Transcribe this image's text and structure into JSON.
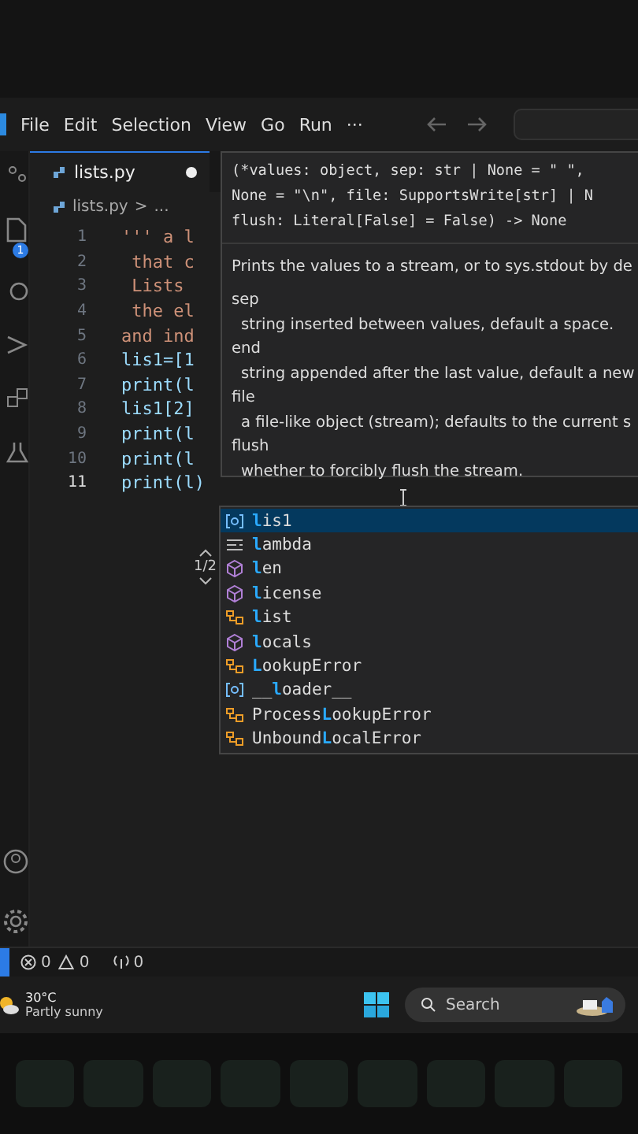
{
  "menu": [
    "File",
    "Edit",
    "Selection",
    "View",
    "Go",
    "Run",
    "···"
  ],
  "activity_badge": "1",
  "tab": {
    "label": "lists.py",
    "modified": true,
    "selected": true
  },
  "breadcrumb": [
    "lists.py",
    "..."
  ],
  "breadcrumb_separator": ">",
  "code_lines": [
    {
      "number": "1",
      "text": "''' a l",
      "kind": "string",
      "current": false
    },
    {
      "number": "2",
      "text": " that c",
      "kind": "string",
      "current": false
    },
    {
      "number": "3",
      "text": " Lists",
      "kind": "string",
      "current": false
    },
    {
      "number": "4",
      "text": " the el",
      "kind": "string",
      "current": false
    },
    {
      "number": "5",
      "text": "and ind",
      "kind": "string",
      "current": false
    },
    {
      "number": "6",
      "text": "lis1=[1",
      "kind": "code",
      "current": false
    },
    {
      "number": "7",
      "text": "print(l",
      "kind": "code",
      "current": false
    },
    {
      "number": "8",
      "text": "lis1[2]",
      "kind": "code",
      "current": false
    },
    {
      "number": "9",
      "text": "print(l",
      "kind": "code",
      "current": false
    },
    {
      "number": "10",
      "text": "print(l",
      "kind": "code",
      "current": false
    },
    {
      "number": "11",
      "text": "print(l)",
      "kind": "code",
      "current": true
    }
  ],
  "hover": {
    "overload": "1/2",
    "signature": [
      "(*values: object, sep: str | None = \" \",",
      "None = \"\\n\", file: SupportsWrite[str] | N",
      "flush: Literal[False] = False) -> None"
    ],
    "summary": "Prints the values to a stream, or to sys.stdout by de",
    "params": [
      {
        "name": "sep",
        "description": "string inserted between values, default a space."
      },
      {
        "name": "end",
        "description": "string appended after the last value, default a new"
      },
      {
        "name": "file",
        "description": "a file-like object (stream); defaults to the current s"
      },
      {
        "name": "flush",
        "description": "whether to forcibly flush the stream."
      }
    ]
  },
  "suggestions": [
    {
      "kind": "variable",
      "match": "l",
      "suffix": "is1",
      "selected": true
    },
    {
      "kind": "keyword",
      "match": "l",
      "suffix": "ambda",
      "selected": false
    },
    {
      "kind": "function",
      "match": "l",
      "suffix": "en",
      "selected": false
    },
    {
      "kind": "function",
      "match": "l",
      "suffix": "icense",
      "selected": false
    },
    {
      "kind": "class",
      "match": "l",
      "suffix": "ist",
      "selected": false
    },
    {
      "kind": "function",
      "match": "l",
      "suffix": "ocals",
      "selected": false
    },
    {
      "kind": "class",
      "match": "L",
      "suffix": "ookupError",
      "selected": false
    },
    {
      "kind": "variable",
      "prefix": "__",
      "match": "l",
      "suffix": "oader__",
      "selected": false
    },
    {
      "kind": "class",
      "prefix": "Process",
      "match": "L",
      "suffix": "ookupError",
      "selected": false
    },
    {
      "kind": "class",
      "prefix": "Unbound",
      "match": "L",
      "suffix": "ocalError",
      "selected": false
    }
  ],
  "status_bar": {
    "errors": "0",
    "warnings": "0",
    "ports": "0"
  },
  "taskbar": {
    "temperature": "30°C",
    "weather": "Partly sunny",
    "search_placeholder": "Search"
  }
}
